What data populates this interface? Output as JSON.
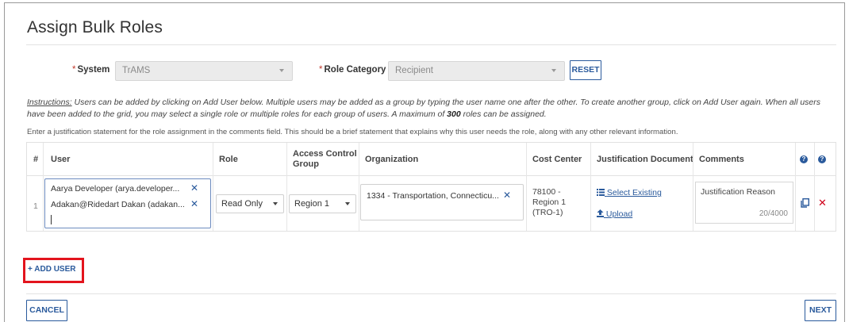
{
  "page": {
    "title": "Assign Bulk Roles"
  },
  "filters": {
    "system_label": "System",
    "system_value": "TrAMS",
    "role_category_label": "Role Category",
    "role_category_value": "Recipient",
    "reset_label": "RESET"
  },
  "instructions": {
    "label": "Instructions:",
    "text_before": " Users can be added by clicking on Add User below. Multiple users may be added as a group by typing the user name one after the other. To create another group, click on Add User again. When all users have been added to the grid, you may select a single role or multiple roles for each group of users. A maximum of ",
    "max_roles": "300",
    "text_after": " roles can be assigned.",
    "justification_note": "Enter a justification statement for the role assignment in the comments field. This should be a brief statement that explains why this user needs the role, along with any other relevant information."
  },
  "grid": {
    "headers": {
      "number": "#",
      "user": "User",
      "role": "Role",
      "access_control_group": "Access Control Group",
      "organization": "Organization",
      "cost_center": "Cost Center",
      "justification_document": "Justification Document",
      "comments": "Comments"
    },
    "rows": [
      {
        "number": "1",
        "users": [
          "Aarya Developer (arya.developer...",
          "Adakan@Ridedart Dakan (adakan..."
        ],
        "role": "Read Only",
        "access_control_group": "Region 1",
        "organization": "1334 - Transportation, Connecticu...",
        "cost_center": "78100 -\nRegion 1\n(TRO-1)",
        "cost_center_lines": [
          "78100 -",
          "Region 1",
          "(TRO-1)"
        ],
        "select_existing_label": "Select Existing",
        "upload_label": "Upload",
        "comment": "Justification Reason",
        "comment_count": "20/4000"
      }
    ]
  },
  "actions": {
    "add_user": "+ ADD USER",
    "cancel": "CANCEL",
    "next": "NEXT"
  },
  "colors": {
    "accent": "#2a5a9c",
    "required": "#c0392b",
    "highlight": "#e3141d",
    "delete": "#d0021b"
  },
  "icons": {
    "help": "question-circle-icon",
    "copy": "copy-icon",
    "delete": "delete-x-icon",
    "list": "list-icon",
    "upload": "upload-icon",
    "remove_token": "remove-token-icon"
  }
}
